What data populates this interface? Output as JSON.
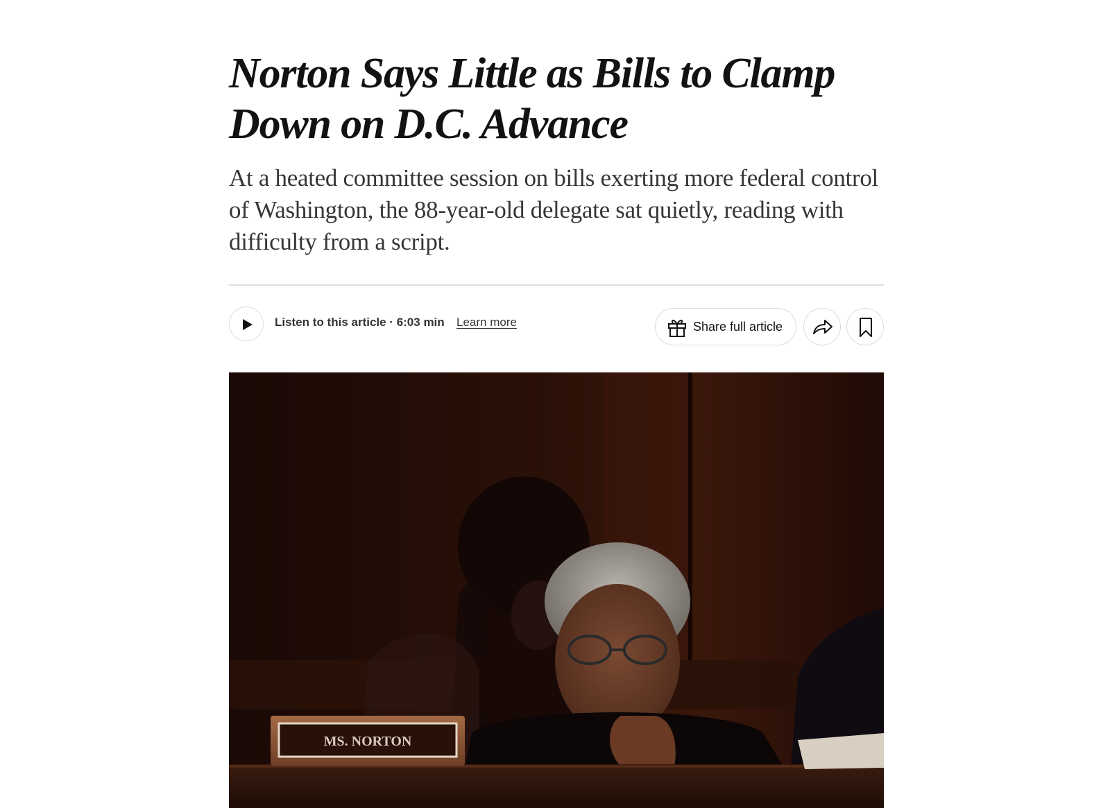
{
  "article": {
    "headline": "Norton Says Little as Bills to Clamp Down on D.C. Advance",
    "summary": "At a heated committee session on bills exerting more federal control of Washington, the 88-year-old delegate sat quietly, reading with difficulty from a script."
  },
  "toolbar": {
    "listen_label": "Listen to this article · 6:03 min",
    "learn_more": "Learn more",
    "share_full_article": "Share full article",
    "play_icon": "play-icon",
    "gift_icon": "gift-icon",
    "share_icon": "share-arrow-icon",
    "bookmark_icon": "bookmark-icon"
  },
  "photo": {
    "nameplate": "MS. NORTON"
  },
  "colors": {
    "text": "#121212",
    "summary": "#363636",
    "border": "#dcdcdc",
    "photo_bg": "#1b0a05"
  }
}
